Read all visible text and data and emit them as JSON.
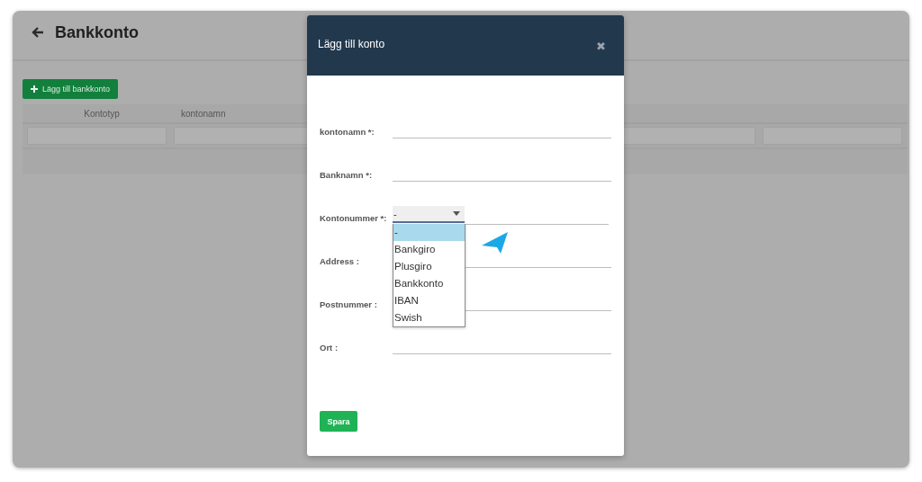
{
  "page": {
    "title": "Bankkonto",
    "add_button": "Lägg till bankkonto"
  },
  "table": {
    "columns": [
      "Kontotyp",
      "kontonamn"
    ]
  },
  "modal": {
    "title": "Lägg till konto",
    "close": "✖",
    "fields": [
      {
        "kind": "text",
        "label": "kontonamn *:"
      },
      {
        "kind": "text",
        "label": "Banknamn *:"
      },
      {
        "kind": "select",
        "label": "Kontonummer *:",
        "value": "-",
        "expanded": true,
        "options": [
          {
            "label": "-",
            "selected": true
          },
          {
            "label": "Bankgiro",
            "selected": false
          },
          {
            "label": "Plusgiro",
            "selected": false
          },
          {
            "label": "Bankkonto",
            "selected": false
          },
          {
            "label": "IBAN",
            "selected": false
          },
          {
            "label": "Swish",
            "selected": false
          }
        ]
      },
      {
        "kind": "text",
        "label": "Address :"
      },
      {
        "kind": "text",
        "label": "Postnummer :"
      },
      {
        "kind": "text",
        "label": "Ort :"
      }
    ],
    "save_button": "Spara"
  }
}
